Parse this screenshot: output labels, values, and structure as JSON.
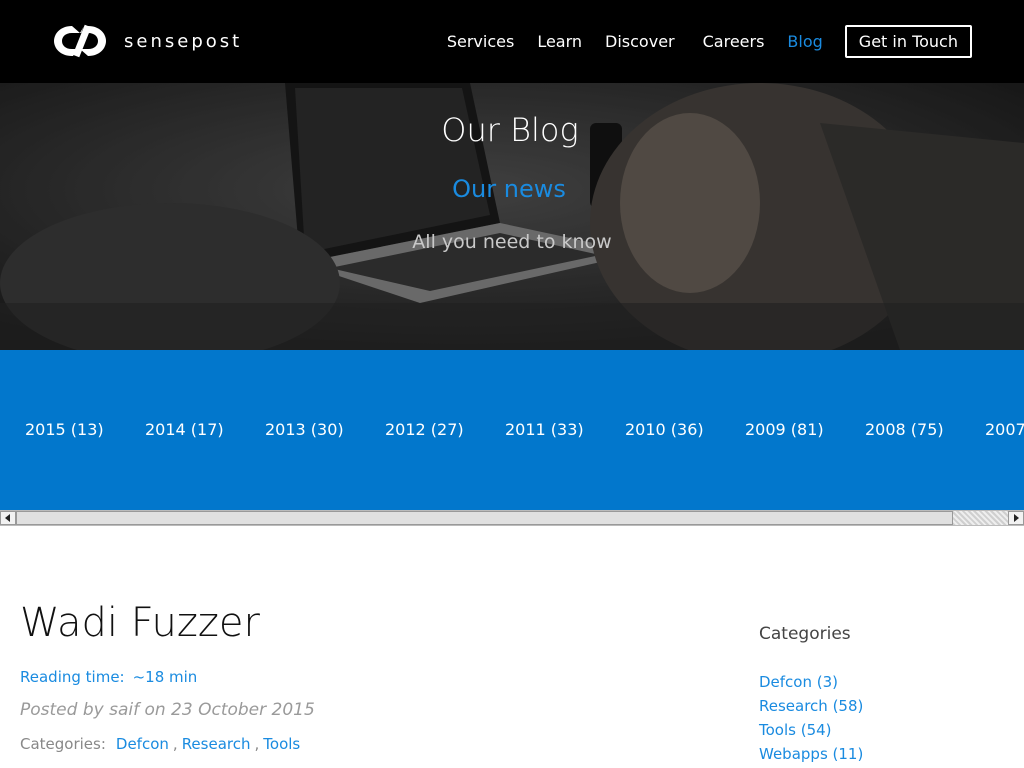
{
  "brand": {
    "name": "sensepost"
  },
  "nav": {
    "items": [
      {
        "label": "Services"
      },
      {
        "label": "Learn"
      },
      {
        "label": "Discover"
      },
      {
        "label": "Careers"
      },
      {
        "label": "Blog"
      }
    ],
    "cta": "Get in Touch",
    "active_index": 4
  },
  "hero": {
    "title": "Our Blog",
    "subtitle": "Our news",
    "tagline": "All you need to know"
  },
  "years": [
    {
      "label": "2015 (13)"
    },
    {
      "label": "2014 (17)"
    },
    {
      "label": "2013 (30)"
    },
    {
      "label": "2012 (27)"
    },
    {
      "label": "2011 (33)"
    },
    {
      "label": "2010 (36)"
    },
    {
      "label": "2009 (81)"
    },
    {
      "label": "2008 (75)"
    },
    {
      "label": "2007"
    }
  ],
  "article": {
    "title": "Wadi Fuzzer",
    "reading_label": "Reading time:",
    "reading_value": "~18 min",
    "posted": "Posted by saif on 23 October 2015",
    "categories_label": "Categories:",
    "categories": [
      "Defcon",
      "Research",
      "Tools"
    ]
  },
  "sidebar": {
    "title": "Categories",
    "items": [
      {
        "label": "Defcon (3)"
      },
      {
        "label": "Research (58)"
      },
      {
        "label": "Tools (54)"
      },
      {
        "label": "Webapps (11)"
      }
    ]
  },
  "colors": {
    "accent": "#1a8be0",
    "year_strip": "#0277cc",
    "header_bg": "#000000"
  }
}
